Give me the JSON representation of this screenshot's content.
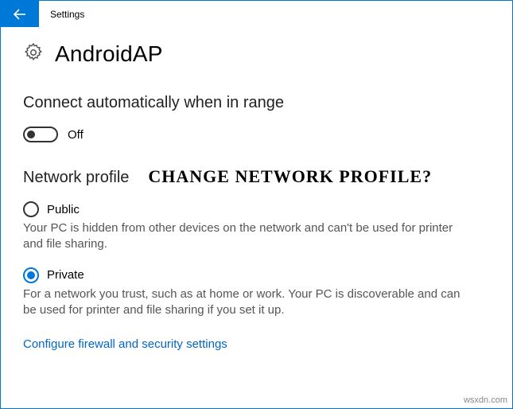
{
  "titlebar": {
    "title": "Settings"
  },
  "page": {
    "title": "AndroidAP"
  },
  "connect": {
    "heading": "Connect automatically when in range",
    "toggle_state": "Off"
  },
  "profile": {
    "heading": "Network profile",
    "annotation": "CHANGE NETWORK PROFILE?",
    "options": [
      {
        "label": "Public",
        "desc": "Your PC is hidden from other devices on the network and can't be used for printer and file sharing.",
        "selected": false
      },
      {
        "label": "Private",
        "desc": "For a network you trust, such as at home or work. Your PC is discoverable and can be used for printer and file sharing if you set it up.",
        "selected": true
      }
    ]
  },
  "link": {
    "label": "Configure firewall and security settings"
  },
  "watermark": "wsxdn.com"
}
